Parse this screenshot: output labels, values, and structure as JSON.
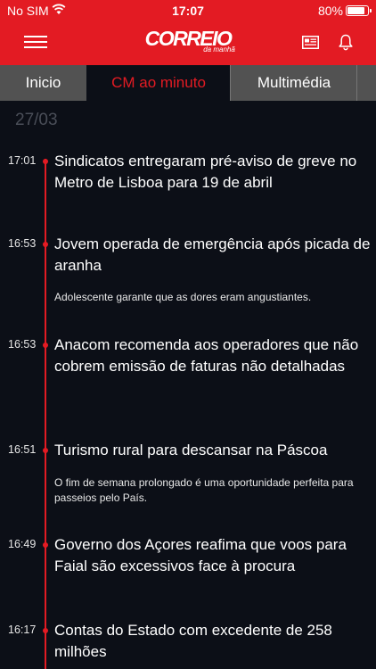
{
  "status_bar": {
    "carrier": "No SIM",
    "time": "17:07",
    "battery": "80%",
    "battery_level": 0.8
  },
  "header": {
    "logo_main": "CORREIO",
    "logo_sub": "da manhã",
    "icons": [
      "menu-icon",
      "newspaper-icon",
      "bell-icon"
    ],
    "background_color": "#e31b23"
  },
  "tabs": [
    {
      "label": "Inicio",
      "active": false
    },
    {
      "label": "CM ao minuto",
      "active": true
    },
    {
      "label": "Multimédia",
      "active": false
    }
  ],
  "feed": {
    "date": "27/03",
    "entries": [
      {
        "time": "17:01",
        "title": "Sindicatos entregaram pré-aviso de greve no Metro de Lisboa para 19 de abril",
        "summary": ""
      },
      {
        "time": "16:53",
        "title": "Jovem operada de emergência após picada de aranha",
        "summary": "Adolescente garante que as dores eram angustiantes."
      },
      {
        "time": "16:53",
        "title": "Anacom recomenda aos operadores que não cobrem emissão de faturas não detalhadas",
        "summary": ""
      },
      {
        "time": "16:51",
        "title": "Turismo rural para descansar na Páscoa",
        "summary": "O fim de semana prolongado é uma oportunidade perfeita para passeios pelo País."
      },
      {
        "time": "16:49",
        "title": "Governo dos Açores reafima que voos para Faial são excessivos face à procura",
        "summary": ""
      },
      {
        "time": "16:17",
        "title": "Contas do Estado com excedente de 258 milhões",
        "summary": ""
      }
    ]
  }
}
